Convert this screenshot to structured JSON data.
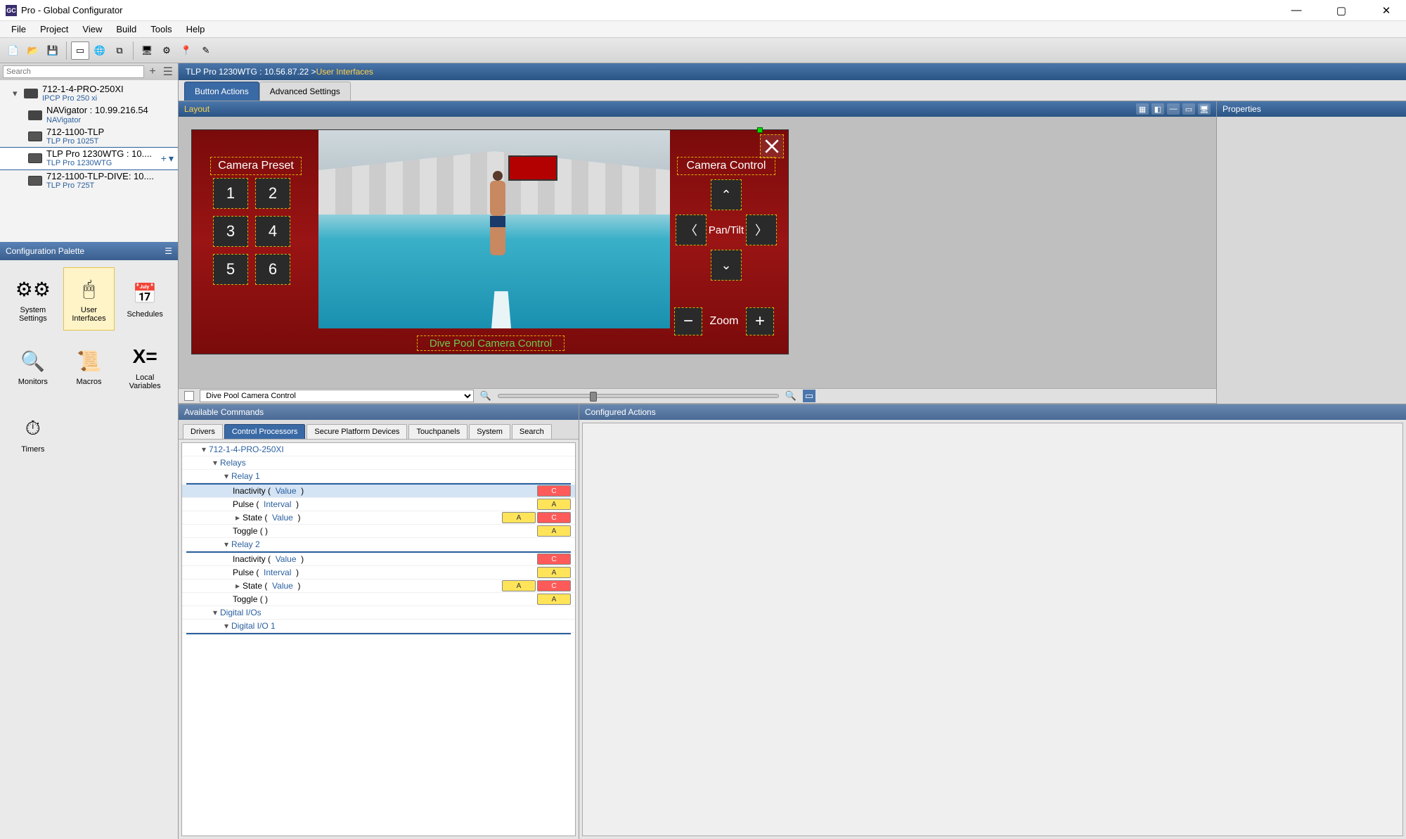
{
  "window": {
    "title": "Pro - Global Configurator"
  },
  "menu": [
    "File",
    "Project",
    "View",
    "Build",
    "Tools",
    "Help"
  ],
  "search": {
    "placeholder": "Search"
  },
  "devices": [
    {
      "name": "712-1-4-PRO-250XI",
      "sub": "IPCP Pro 250 xi"
    },
    {
      "name": "NAVigator : 10.99.216.54",
      "sub": "NAVigator"
    },
    {
      "name": "712-1100-TLP",
      "sub": "TLP Pro 1025T"
    },
    {
      "name": "TLP Pro 1230WTG : 10....",
      "sub": "TLP Pro 1230WTG",
      "selected": true
    },
    {
      "name": "712-1100-TLP-DIVE: 10....",
      "sub": "TLP Pro 725T"
    }
  ],
  "palette": {
    "header": "Configuration Palette",
    "items": [
      "System Settings",
      "User Interfaces",
      "Schedules",
      "Monitors",
      "Macros",
      "Local Variables",
      "Timers"
    ]
  },
  "breadcrumb": {
    "a": "TLP Pro 1230WTG : 10.56.87.22 > ",
    "b": "User Interfaces"
  },
  "tabs": {
    "a": "Button Actions",
    "b": "Advanced Settings"
  },
  "layout": {
    "header": "Layout"
  },
  "properties": {
    "header": "Properties"
  },
  "touchpanel": {
    "preset": "Camera Preset",
    "control": "Camera Control",
    "pan": "Pan/Tilt",
    "zoom": "Zoom",
    "presets": [
      "1",
      "2",
      "3",
      "4",
      "5",
      "6"
    ],
    "page": "Dive Pool Camera Control"
  },
  "layerbar": {
    "name": "Dive Pool Camera Control"
  },
  "avail": {
    "header": "Available Commands"
  },
  "conf": {
    "header": "Configured Actions"
  },
  "cmdtabs": [
    "Drivers",
    "Control Processors",
    "Secure Platform Devices",
    "Touchpanels",
    "System",
    "Search"
  ],
  "tree": {
    "root": "712-1-4-PRO-250XI",
    "relays": "Relays",
    "r1": "Relay 1",
    "r2": "Relay 2",
    "dio": "Digital I/Os",
    "dio1": "Digital I/O 1",
    "inact": "Inactivity",
    "pulse": "Pulse",
    "state": "State",
    "toggle": "Toggle",
    "value": "Value",
    "interval": "Interval"
  }
}
